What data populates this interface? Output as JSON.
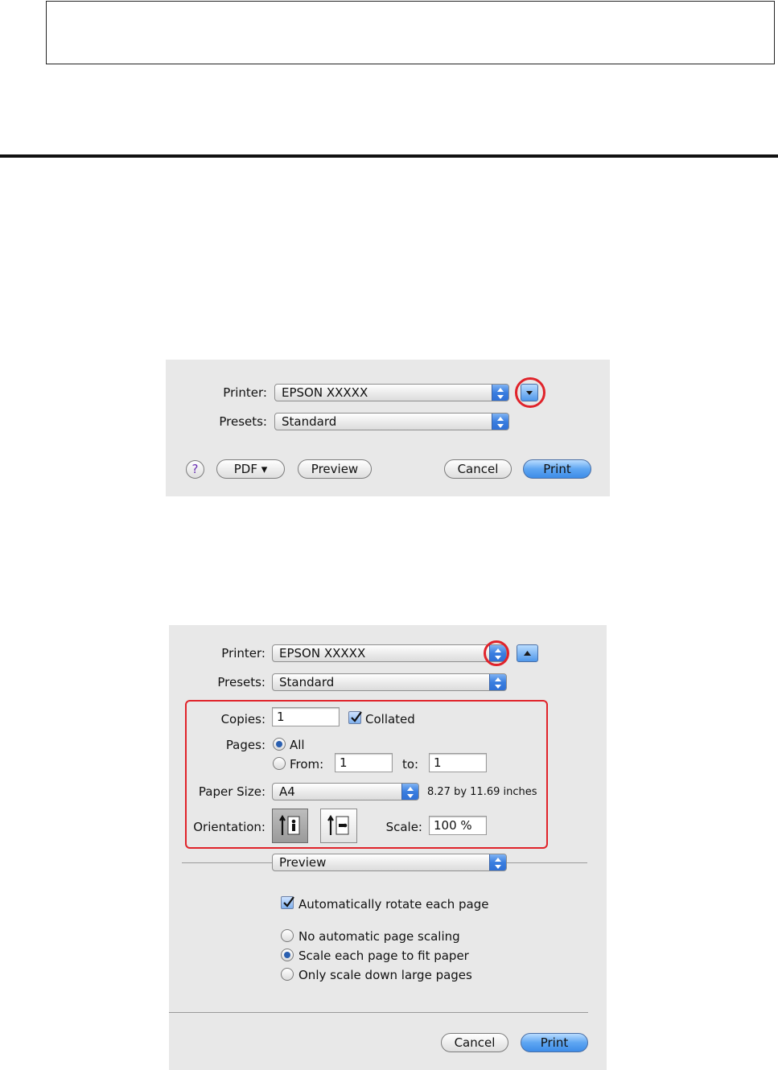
{
  "dialog_small": {
    "printer_label": "Printer:",
    "printer_value": "EPSON XXXXX",
    "presets_label": "Presets:",
    "presets_value": "Standard",
    "help_label": "?",
    "pdf_label": "PDF ▾",
    "preview_label": "Preview",
    "cancel_label": "Cancel",
    "print_label": "Print"
  },
  "dialog_expanded": {
    "printer_label": "Printer:",
    "printer_value": "EPSON XXXXX",
    "presets_label": "Presets:",
    "presets_value": "Standard",
    "copies_label": "Copies:",
    "copies_value": "1",
    "collated_label": "Collated",
    "pages_label": "Pages:",
    "pages_all_label": "All",
    "pages_from_label": "From:",
    "pages_from_value": "1",
    "pages_to_label": "to:",
    "pages_to_value": "1",
    "paper_size_label": "Paper Size:",
    "paper_size_value": "A4",
    "paper_size_dims": "8.27 by 11.69 inches",
    "orientation_label": "Orientation:",
    "scale_label": "Scale:",
    "scale_value": "100 %",
    "section_popup_value": "Preview",
    "auto_rotate_label": "Automatically rotate each page",
    "scaling_options": [
      "No automatic page scaling",
      "Scale each page to fit paper",
      "Only scale down large pages"
    ],
    "cancel_label": "Cancel",
    "print_label": "Print"
  },
  "colors": {
    "highlight_red": "#e0232a",
    "dialog_bg": "#e8e8e8",
    "accent_blue": "#3d8ce8"
  },
  "icons": [
    "disclosure-down-icon",
    "disclosure-up-icon",
    "stepper-icon",
    "help-icon",
    "portrait-icon",
    "landscape-icon",
    "checkmark-icon"
  ]
}
